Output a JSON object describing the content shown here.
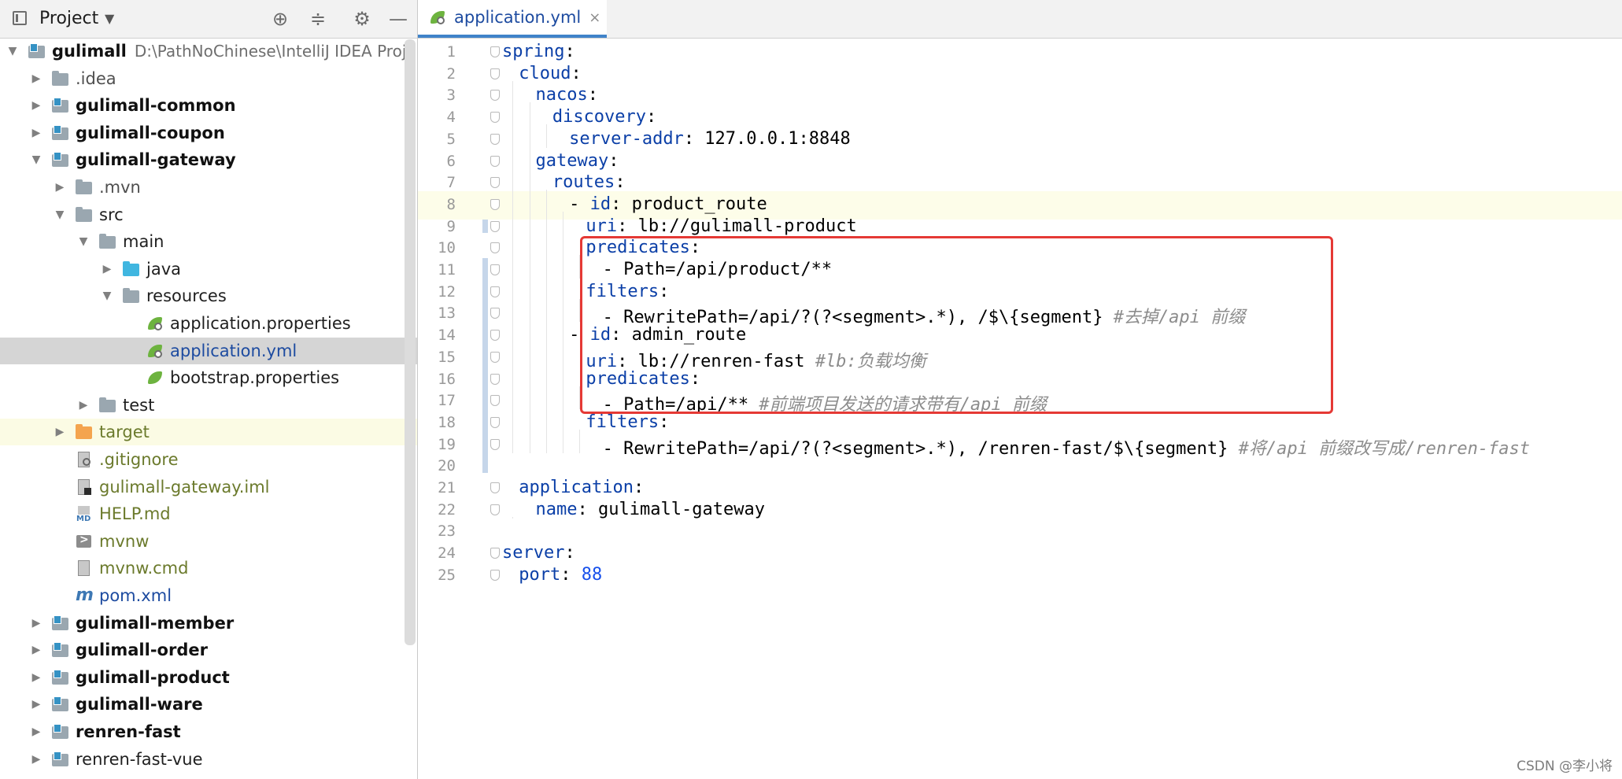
{
  "project_panel": {
    "title": "Project",
    "tree": [
      {
        "label": "gulimall",
        "path": "D:\\PathNoChinese\\IntelliJ IDEA Proje",
        "arrow": "▼",
        "indent": 0,
        "icon": "module",
        "style": "bold"
      },
      {
        "label": ".idea",
        "arrow": "▶",
        "indent": 1,
        "icon": "folder",
        "style": "dim"
      },
      {
        "label": "gulimall-common",
        "arrow": "▶",
        "indent": 1,
        "icon": "module",
        "style": "bold"
      },
      {
        "label": "gulimall-coupon",
        "arrow": "▶",
        "indent": 1,
        "icon": "module",
        "style": "bold"
      },
      {
        "label": "gulimall-gateway",
        "arrow": "▼",
        "indent": 1,
        "icon": "module",
        "style": "bold"
      },
      {
        "label": ".mvn",
        "arrow": "▶",
        "indent": 2,
        "icon": "folder",
        "style": "dim"
      },
      {
        "label": "src",
        "arrow": "▼",
        "indent": 2,
        "icon": "folder",
        "style": ""
      },
      {
        "label": "main",
        "arrow": "▼",
        "indent": 3,
        "icon": "folder",
        "style": ""
      },
      {
        "label": "java",
        "arrow": "▶",
        "indent": 4,
        "icon": "folder-blue",
        "style": ""
      },
      {
        "label": "resources",
        "arrow": "▼",
        "indent": 4,
        "icon": "folder",
        "style": ""
      },
      {
        "label": "application.properties",
        "arrow": "",
        "indent": 5,
        "icon": "leaf-gear",
        "style": ""
      },
      {
        "label": "application.yml",
        "arrow": "",
        "indent": 5,
        "icon": "leaf-gear",
        "style": "blue",
        "selected": true
      },
      {
        "label": "bootstrap.properties",
        "arrow": "",
        "indent": 5,
        "icon": "leaf",
        "style": ""
      },
      {
        "label": "test",
        "arrow": "▶",
        "indent": 3,
        "icon": "folder",
        "style": ""
      },
      {
        "label": "target",
        "arrow": "▶",
        "indent": 2,
        "icon": "folder-orange",
        "style": "olive",
        "excluded": true
      },
      {
        "label": ".gitignore",
        "arrow": "",
        "indent": 2,
        "icon": "file-ignore",
        "style": "olive"
      },
      {
        "label": "gulimall-gateway.iml",
        "arrow": "",
        "indent": 2,
        "icon": "file-dark",
        "style": "olive"
      },
      {
        "label": "HELP.md",
        "arrow": "",
        "indent": 2,
        "icon": "md",
        "style": "olive"
      },
      {
        "label": "mvnw",
        "arrow": "",
        "indent": 2,
        "icon": "term",
        "style": "olive"
      },
      {
        "label": "mvnw.cmd",
        "arrow": "",
        "indent": 2,
        "icon": "file",
        "style": "olive"
      },
      {
        "label": "pom.xml",
        "arrow": "",
        "indent": 2,
        "icon": "mvn",
        "style": "blue"
      },
      {
        "label": "gulimall-member",
        "arrow": "▶",
        "indent": 1,
        "icon": "module",
        "style": "bold"
      },
      {
        "label": "gulimall-order",
        "arrow": "▶",
        "indent": 1,
        "icon": "module",
        "style": "bold"
      },
      {
        "label": "gulimall-product",
        "arrow": "▶",
        "indent": 1,
        "icon": "module",
        "style": "bold"
      },
      {
        "label": "gulimall-ware",
        "arrow": "▶",
        "indent": 1,
        "icon": "module",
        "style": "bold"
      },
      {
        "label": "renren-fast",
        "arrow": "▶",
        "indent": 1,
        "icon": "module",
        "style": "bold"
      },
      {
        "label": "renren-fast-vue",
        "arrow": "▶",
        "indent": 1,
        "icon": "module",
        "style": ""
      }
    ]
  },
  "editor": {
    "tab_label": "application.yml",
    "tab_close": "×",
    "current_line": 8,
    "highlight_box_lines": [
      8,
      13
    ],
    "lines": [
      {
        "n": 1,
        "indent": 0,
        "tokens": [
          [
            "k",
            "spring"
          ],
          [
            "v",
            ":"
          ]
        ]
      },
      {
        "n": 2,
        "indent": 1,
        "tokens": [
          [
            "k",
            "cloud"
          ],
          [
            "v",
            ":"
          ]
        ]
      },
      {
        "n": 3,
        "indent": 2,
        "tokens": [
          [
            "k",
            "nacos"
          ],
          [
            "v",
            ":"
          ]
        ]
      },
      {
        "n": 4,
        "indent": 3,
        "tokens": [
          [
            "k",
            "discovery"
          ],
          [
            "v",
            ":"
          ]
        ]
      },
      {
        "n": 5,
        "indent": 4,
        "tokens": [
          [
            "k",
            "server-addr"
          ],
          [
            "v",
            ": 127.0.0.1:8848"
          ]
        ]
      },
      {
        "n": 6,
        "indent": 2,
        "tokens": [
          [
            "k",
            "gateway"
          ],
          [
            "v",
            ":"
          ]
        ]
      },
      {
        "n": 7,
        "indent": 3,
        "tokens": [
          [
            "k",
            "routes"
          ],
          [
            "v",
            ":"
          ]
        ]
      },
      {
        "n": 8,
        "indent": 4,
        "tokens": [
          [
            "v",
            "- "
          ],
          [
            "k",
            "id"
          ],
          [
            "v",
            ": product_route"
          ]
        ]
      },
      {
        "n": 9,
        "indent": 5,
        "tokens": [
          [
            "k",
            "uri"
          ],
          [
            "v",
            ": lb://gulimall-product"
          ]
        ]
      },
      {
        "n": 10,
        "indent": 5,
        "tokens": [
          [
            "k",
            "predicates"
          ],
          [
            "v",
            ":"
          ]
        ]
      },
      {
        "n": 11,
        "indent": 6,
        "tokens": [
          [
            "v",
            "- Path=/api/product/**"
          ]
        ]
      },
      {
        "n": 12,
        "indent": 5,
        "tokens": [
          [
            "k",
            "filters"
          ],
          [
            "v",
            ":"
          ]
        ]
      },
      {
        "n": 13,
        "indent": 6,
        "tokens": [
          [
            "v",
            "- RewritePath=/api/?(?<segment>.*), /$\\{segment} "
          ],
          [
            "cm",
            "#去掉/api 前缀"
          ]
        ]
      },
      {
        "n": 14,
        "indent": 4,
        "tokens": [
          [
            "v",
            "- "
          ],
          [
            "k",
            "id"
          ],
          [
            "v",
            ": admin_route"
          ]
        ]
      },
      {
        "n": 15,
        "indent": 5,
        "tokens": [
          [
            "k",
            "uri"
          ],
          [
            "v",
            ": lb://renren-fast "
          ],
          [
            "cm",
            "#lb:负载均衡"
          ]
        ]
      },
      {
        "n": 16,
        "indent": 5,
        "tokens": [
          [
            "k",
            "predicates"
          ],
          [
            "v",
            ":"
          ]
        ]
      },
      {
        "n": 17,
        "indent": 6,
        "tokens": [
          [
            "v",
            "- Path=/api/** "
          ],
          [
            "cm",
            "#前端项目发送的请求带有/api 前缀"
          ]
        ]
      },
      {
        "n": 18,
        "indent": 5,
        "tokens": [
          [
            "k",
            "filters"
          ],
          [
            "v",
            ":"
          ]
        ]
      },
      {
        "n": 19,
        "indent": 6,
        "tokens": [
          [
            "v",
            "- RewritePath=/api/?(?<segment>.*), /renren-fast/$\\{segment} "
          ],
          [
            "cm",
            "#将/api 前缀改写成/renren-fast"
          ]
        ]
      },
      {
        "n": 20,
        "indent": 0,
        "tokens": []
      },
      {
        "n": 21,
        "indent": 1,
        "tokens": [
          [
            "k",
            "application"
          ],
          [
            "v",
            ":"
          ]
        ]
      },
      {
        "n": 22,
        "indent": 2,
        "tokens": [
          [
            "k",
            "name"
          ],
          [
            "v",
            ": gulimall-gateway"
          ]
        ]
      },
      {
        "n": 23,
        "indent": 0,
        "tokens": []
      },
      {
        "n": 24,
        "indent": 0,
        "tokens": [
          [
            "k",
            "server"
          ],
          [
            "v",
            ":"
          ]
        ]
      },
      {
        "n": 25,
        "indent": 1,
        "tokens": [
          [
            "k",
            "port"
          ],
          [
            "v",
            ": "
          ],
          [
            "n",
            "88"
          ]
        ]
      }
    ]
  },
  "watermark": "CSDN @李小将"
}
